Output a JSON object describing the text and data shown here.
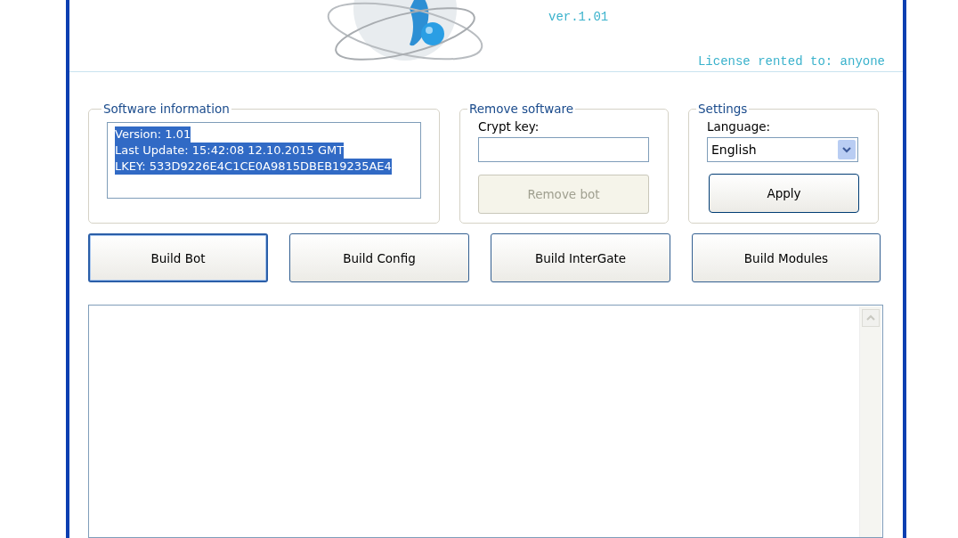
{
  "header": {
    "version": "ver.1.01",
    "license": "License rented to: anyone"
  },
  "software_information": {
    "title": "Software information",
    "lines": [
      "Version: 1.01",
      "Last Update: 15:42:08 12.10.2015 GMT",
      "LKEY: 533D9226E4C1CE0A9815DBEB19235AE4"
    ],
    "selected": true
  },
  "remove_software": {
    "title": "Remove software",
    "label": "Crypt key:",
    "button": {
      "label": "Remove bot",
      "disabled": true
    }
  },
  "settings": {
    "title": "Settings",
    "label": "Language:",
    "value": "English",
    "button": {
      "label": "Apply",
      "disabled": false
    }
  },
  "buttons": [
    {
      "label": "Build Bot",
      "focused": true
    },
    {
      "label": "Build Config",
      "focused": false
    },
    {
      "label": "Build InterGate",
      "focused": false
    },
    {
      "label": "Build Modules",
      "focused": false
    }
  ]
}
